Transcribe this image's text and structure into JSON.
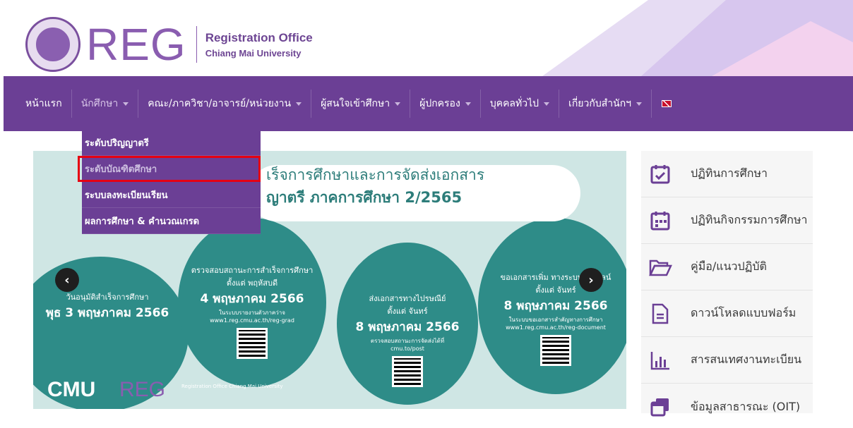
{
  "header": {
    "logo_text": "REG",
    "office_name": "Registration Office",
    "university": "Chiang Mai University",
    "seal_text": "Chiang Mai University"
  },
  "nav": {
    "items": [
      {
        "label": "หน้าแรก",
        "dropdown": false
      },
      {
        "label": "นักศึกษา",
        "dropdown": true
      },
      {
        "label": "คณะ/ภาควิชา/อาจารย์/หน่วยงาน",
        "dropdown": true
      },
      {
        "label": "ผู้สนใจเข้าศึกษา",
        "dropdown": true
      },
      {
        "label": "ผู้ปกครอง",
        "dropdown": true
      },
      {
        "label": "บุคคลทั่วไป",
        "dropdown": true
      },
      {
        "label": "เกี่ยวกับสำนักฯ",
        "dropdown": true
      }
    ],
    "language_icon": "uk-flag-icon"
  },
  "dropdown": {
    "items": [
      {
        "label": "ระดับปริญญาตรี"
      },
      {
        "label": "ระดับบัณฑิตศึกษา"
      },
      {
        "label": "ระบบลงทะเบียนเรียน"
      },
      {
        "label": "ผลการศึกษา & คำนวณเกรด"
      }
    ]
  },
  "banner": {
    "title_line1": "เร็จการศึกษาและการจัดส่งเอกสาร",
    "title_line2": "ญาตรี ภาคการศึกษา 2/2565",
    "col1": {
      "line1": "วันอนุมัติสำเร็จการศึกษา",
      "date": "พุธ 3 พฤษภาคม 2566"
    },
    "col2": {
      "line1": "ตรวจสอบสถานะการสำเร็จการศึกษา",
      "line2": "ตั้งแต่ พฤหัสบดี",
      "date": "4 พฤษภาคม 2566",
      "note": "ในระบบรายงานตัวภาคว่าจ",
      "url": "www1.reg.cmu.ac.th/reg-grad"
    },
    "col3": {
      "line1": "ส่งเอกสารทางไปรษณีย์",
      "line2": "ตั้งแต่ จันทร์",
      "date": "8 พฤษภาคม 2566",
      "note": "ตรวจสอบสถานะการจัดส่งได้ที่",
      "url": "cmu.to/post"
    },
    "col4": {
      "line1": "ขอเอกสารเพิ่ม ทางระบบออนไลน์",
      "line2": "ตั้งแต่ จันทร์",
      "date": "8 พฤษภาคม 2566",
      "note": "ในระบบขอเอกสารสำคัญทางการศึกษา",
      "url": "www1.reg.cmu.ac.th/reg-document"
    },
    "footer_cmu": "CMU",
    "footer_reg": "REG",
    "footer_small": "Registration Office Chiang Mai University",
    "prev_icon": "chevron-left-icon",
    "next_icon": "chevron-right-icon"
  },
  "side": {
    "items": [
      {
        "label": "ปฏิทินการศึกษา",
        "icon": "calendar-check-icon"
      },
      {
        "label": "ปฏิทินกิจกรรมการศึกษา",
        "icon": "calendar-icon"
      },
      {
        "label": "คู่มือ/แนวปฏิบัติ",
        "icon": "folder-open-icon"
      },
      {
        "label": "ดาวน์โหลดแบบฟอร์ม",
        "icon": "file-icon"
      },
      {
        "label": "สารสนเทศงานทะเบียน",
        "icon": "bar-chart-icon"
      },
      {
        "label": "ข้อมูลสาธารณะ (OIT)",
        "icon": "windows-icon"
      }
    ]
  },
  "colors": {
    "brand_purple": "#6b3f95",
    "highlight_red": "#e60012",
    "teal": "#2e8c88"
  }
}
